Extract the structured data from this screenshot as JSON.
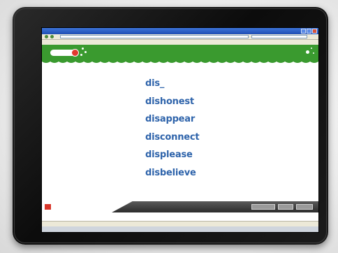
{
  "browser": {
    "title": "",
    "url": ""
  },
  "menu": [
    "",
    "",
    "",
    "",
    ""
  ],
  "header": {
    "left_text": "",
    "right_text": ""
  },
  "lesson": {
    "words": [
      "dis_",
      "dishonest",
      "disappear",
      "disconnect",
      "displease",
      "disbelieve"
    ]
  },
  "colors": {
    "accent_green": "#3a9a2f",
    "word_blue": "#2f64ab",
    "logo_red": "#e23a2f"
  },
  "icons": [
    "back-icon",
    "forward-icon",
    "close-icon",
    "minimize-icon",
    "maximize-icon"
  ]
}
